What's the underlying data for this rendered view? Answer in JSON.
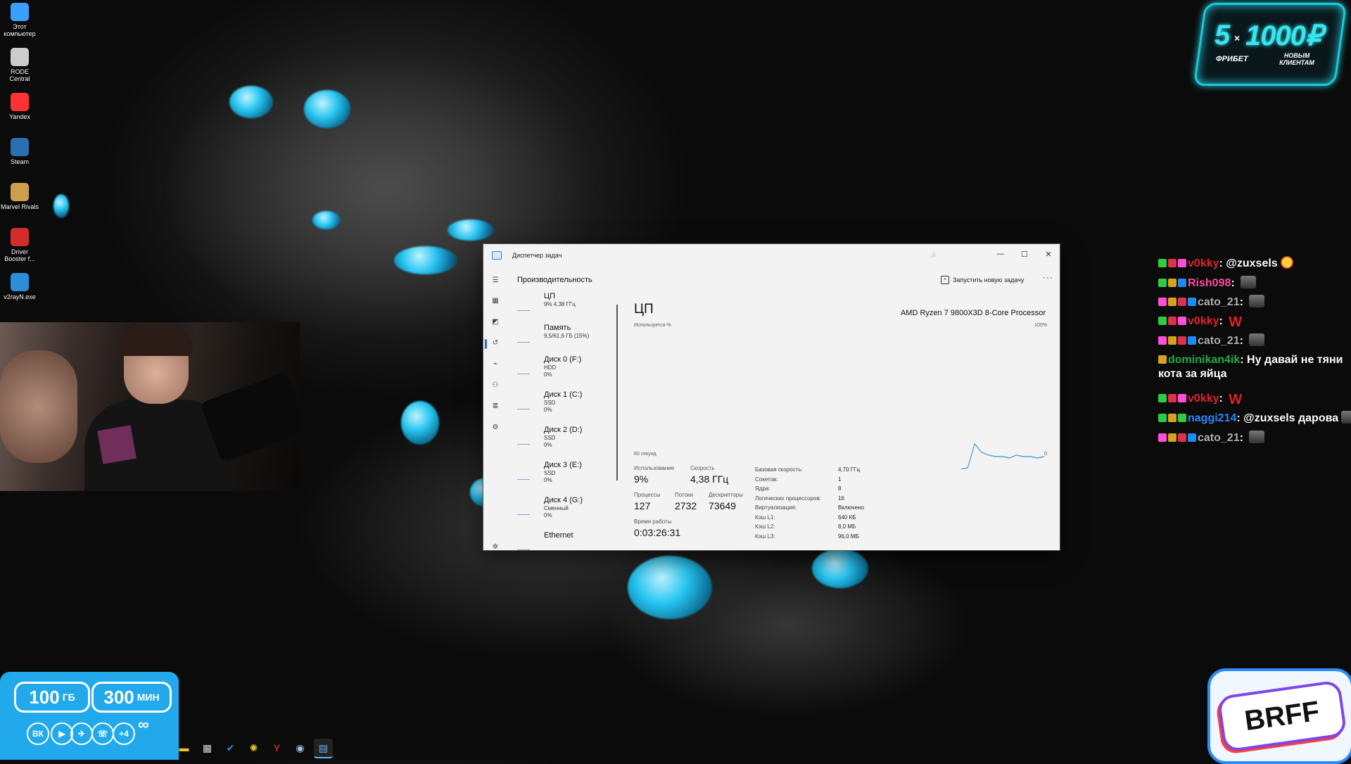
{
  "desktop_icons": [
    {
      "label": "Этот компьютер",
      "icon": "monitor-icon",
      "color": "#3aa0ff"
    },
    {
      "label": "RODE Central",
      "icon": "rode-icon",
      "color": "#cccccc"
    },
    {
      "label": "Yandex",
      "icon": "yandex-icon",
      "color": "#ff3333"
    },
    {
      "label": "Steam",
      "icon": "steam-icon",
      "color": "#2a6fb0"
    },
    {
      "label": "Marvel Rivals",
      "icon": "marvel-icon",
      "color": "#c9a14a"
    },
    {
      "label": "Driver Booster f...",
      "icon": "driver-booster-icon",
      "color": "#d22d2d"
    },
    {
      "label": "v2rayN.exe",
      "icon": "v2ray-icon",
      "color": "#2a8fd8"
    }
  ],
  "task_manager": {
    "title": "Диспетчер задач",
    "section_heading": "Производительность",
    "run_new_task": "Запустить новую задачу",
    "more_glyph": "···",
    "window_controls": {
      "minimize": "—",
      "maximize": "☐",
      "close": "✕"
    },
    "devices": [
      {
        "name": "ЦП",
        "sub1": "9% 4,38 ГГц",
        "sub2": "",
        "sub3": ""
      },
      {
        "name": "Память",
        "sub1": "9,5/61,6 ГБ (15%)",
        "sub2": "",
        "sub3": ""
      },
      {
        "name": "Диск 0 (F:)",
        "sub1": "HDD",
        "sub2": "0%",
        "sub3": ""
      },
      {
        "name": "Диск 1 (C:)",
        "sub1": "SSD",
        "sub2": "0%",
        "sub3": ""
      },
      {
        "name": "Диск 2 (D:)",
        "sub1": "SSD",
        "sub2": "0%",
        "sub3": ""
      },
      {
        "name": "Диск 3 (E:)",
        "sub1": "SSD",
        "sub2": "0%",
        "sub3": ""
      },
      {
        "name": "Диск 4 (G:)",
        "sub1": "Сменный",
        "sub2": "0%",
        "sub3": ""
      },
      {
        "name": "Ethernet",
        "sub1": "",
        "sub2": "",
        "sub3": ""
      }
    ],
    "main": {
      "title": "ЦП",
      "usage_label": "Используется %",
      "processor": "AMD Ryzen 7 9800X3D 8-Core Processor",
      "max_label": "100%",
      "time_label": "60 секунд",
      "min_label": "0",
      "stats": {
        "usage_label": "Использование",
        "usage": "9%",
        "speed_label": "Скорость",
        "speed": "4,38 ГГц",
        "processes_label": "Процессы",
        "processes": "127",
        "threads_label": "Потоки",
        "threads": "2732",
        "handles_label": "Дескрипторы",
        "handles": "73649",
        "uptime_label": "Время работы",
        "uptime": "0:03:26:31"
      },
      "specs": [
        {
          "label": "Базовая скорость:",
          "value": "4,70 ГГц"
        },
        {
          "label": "Сокетов:",
          "value": "1"
        },
        {
          "label": "Ядра:",
          "value": "8"
        },
        {
          "label": "Логических процессоров:",
          "value": "16"
        },
        {
          "label": "Виртуализация:",
          "value": "Включено"
        },
        {
          "label": "Кэш L1:",
          "value": "640 КБ"
        },
        {
          "label": "Кэш L2:",
          "value": "8,0 МБ"
        },
        {
          "label": "Кэш L3:",
          "value": "96,0 МБ"
        }
      ],
      "cpu_history_percent": [
        0,
        0,
        0,
        0,
        0,
        0,
        0,
        0,
        0,
        0,
        0,
        0,
        0,
        0,
        0,
        0,
        0,
        0,
        0,
        0,
        0,
        0,
        0,
        0,
        0,
        0,
        0,
        0,
        0,
        0,
        0,
        0,
        0,
        0,
        0,
        0,
        0,
        0,
        0,
        0,
        0,
        0,
        0,
        0,
        0,
        0,
        0,
        0,
        1,
        18,
        12,
        10,
        9,
        9,
        8,
        10,
        9,
        9,
        8,
        9
      ],
      "graph_color": "#4aa3df"
    }
  },
  "chat": [
    {
      "badges": [
        "green",
        "red",
        "pink"
      ],
      "user": "v0kky",
      "user_color": "#e8232b",
      "text": "@zuxsels",
      "emote": "face"
    },
    {
      "badges": [
        "green",
        "gold",
        "blue"
      ],
      "user": "Rish098",
      "user_color": "#ff4fa3",
      "text": "",
      "emote": "dark"
    },
    {
      "badges": [
        "pink",
        "gold",
        "red",
        "blue"
      ],
      "user": "cato_21",
      "user_color": "#b0b0b0",
      "text": "",
      "emote": "dark"
    },
    {
      "badges": [
        "green",
        "red",
        "pink"
      ],
      "user": "v0kky",
      "user_color": "#e8232b",
      "text": "",
      "emote": "w"
    },
    {
      "badges": [
        "pink",
        "gold",
        "red",
        "blue"
      ],
      "user": "cato_21",
      "user_color": "#b0b0b0",
      "text": "",
      "emote": "dark"
    },
    {
      "badges": [
        "gold"
      ],
      "user": "dominikan4ik",
      "user_color": "#22b14c",
      "text": "Ну давай не тяни кота за яйца",
      "emote": ""
    },
    {
      "badges": [
        "green",
        "red",
        "pink"
      ],
      "user": "v0kky",
      "user_color": "#e8232b",
      "text": "",
      "emote": "w"
    },
    {
      "badges": [
        "green",
        "gold",
        "green"
      ],
      "user": "naggi214",
      "user_color": "#2b8cff",
      "text": "@zuxsels дарова",
      "emote": "dark"
    },
    {
      "badges": [
        "pink",
        "gold",
        "red",
        "blue"
      ],
      "user": "cato_21",
      "user_color": "#b0b0b0",
      "text": "",
      "emote": "dark"
    }
  ],
  "promo": {
    "count": "5",
    "x": "×",
    "amount": "1000₽",
    "left": "ФРИБЕТ",
    "right": "НОВЫМ КЛИЕНТАМ"
  },
  "plan": {
    "gb": "100",
    "gb_unit": "ГБ",
    "min": "300",
    "min_unit": "МИН",
    "socials": [
      "ВК",
      "▶",
      "✈",
      "☏",
      "+4"
    ],
    "infinity": "∞"
  },
  "brff": {
    "label": "BRFF"
  },
  "taskbar": [
    {
      "icon": "file-explorer-icon",
      "glyph": "▬",
      "color": "#f2c12e"
    },
    {
      "icon": "calendar-icon",
      "glyph": "▦",
      "color": "#dddddd"
    },
    {
      "icon": "v2ray-icon",
      "glyph": "✔",
      "color": "#2a8fd8"
    },
    {
      "icon": "sun-app-icon",
      "glyph": "✺",
      "color": "#f2c12e"
    },
    {
      "icon": "yandex-icon",
      "glyph": "Y",
      "color": "#ff3333"
    },
    {
      "icon": "steam-icon",
      "glyph": "◉",
      "color": "#9cc8f0"
    },
    {
      "icon": "task-manager-icon",
      "glyph": "▤",
      "color": "#6bb8ff"
    }
  ]
}
